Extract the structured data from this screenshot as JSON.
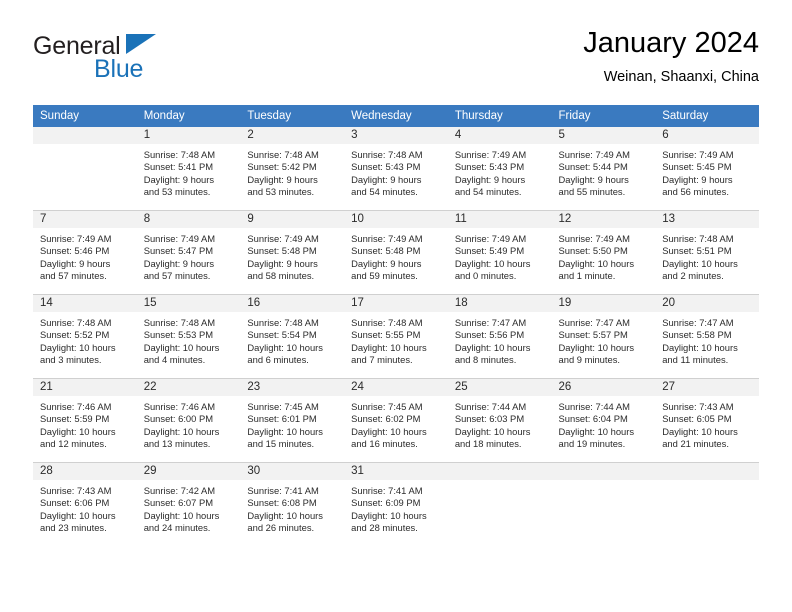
{
  "brand": {
    "name_part1": "General",
    "name_part2": "Blue",
    "triangle_icon": "triangle-logo-icon",
    "color_primary": "#1a72b8",
    "color_text": "#231f20"
  },
  "header": {
    "title": "January 2024",
    "subtitle": "Weinan, Shaanxi, China"
  },
  "theme": {
    "header_bg": "#3a7ac0",
    "header_text": "#ffffff",
    "daynum_band_bg": "#f2f2f2",
    "grid_line": "#d0d0d0",
    "page_bg": "#ffffff"
  },
  "weekday_headers": [
    "Sunday",
    "Monday",
    "Tuesday",
    "Wednesday",
    "Thursday",
    "Friday",
    "Saturday"
  ],
  "weeks": [
    [
      {
        "day": "",
        "empty": true,
        "sunrise": "",
        "sunset": "",
        "daylight_line1": "",
        "daylight_line2": ""
      },
      {
        "day": "1",
        "empty": false,
        "sunrise": "Sunrise: 7:48 AM",
        "sunset": "Sunset: 5:41 PM",
        "daylight_line1": "Daylight: 9 hours",
        "daylight_line2": "and 53 minutes."
      },
      {
        "day": "2",
        "empty": false,
        "sunrise": "Sunrise: 7:48 AM",
        "sunset": "Sunset: 5:42 PM",
        "daylight_line1": "Daylight: 9 hours",
        "daylight_line2": "and 53 minutes."
      },
      {
        "day": "3",
        "empty": false,
        "sunrise": "Sunrise: 7:48 AM",
        "sunset": "Sunset: 5:43 PM",
        "daylight_line1": "Daylight: 9 hours",
        "daylight_line2": "and 54 minutes."
      },
      {
        "day": "4",
        "empty": false,
        "sunrise": "Sunrise: 7:49 AM",
        "sunset": "Sunset: 5:43 PM",
        "daylight_line1": "Daylight: 9 hours",
        "daylight_line2": "and 54 minutes."
      },
      {
        "day": "5",
        "empty": false,
        "sunrise": "Sunrise: 7:49 AM",
        "sunset": "Sunset: 5:44 PM",
        "daylight_line1": "Daylight: 9 hours",
        "daylight_line2": "and 55 minutes."
      },
      {
        "day": "6",
        "empty": false,
        "sunrise": "Sunrise: 7:49 AM",
        "sunset": "Sunset: 5:45 PM",
        "daylight_line1": "Daylight: 9 hours",
        "daylight_line2": "and 56 minutes."
      }
    ],
    [
      {
        "day": "7",
        "empty": false,
        "sunrise": "Sunrise: 7:49 AM",
        "sunset": "Sunset: 5:46 PM",
        "daylight_line1": "Daylight: 9 hours",
        "daylight_line2": "and 57 minutes."
      },
      {
        "day": "8",
        "empty": false,
        "sunrise": "Sunrise: 7:49 AM",
        "sunset": "Sunset: 5:47 PM",
        "daylight_line1": "Daylight: 9 hours",
        "daylight_line2": "and 57 minutes."
      },
      {
        "day": "9",
        "empty": false,
        "sunrise": "Sunrise: 7:49 AM",
        "sunset": "Sunset: 5:48 PM",
        "daylight_line1": "Daylight: 9 hours",
        "daylight_line2": "and 58 minutes."
      },
      {
        "day": "10",
        "empty": false,
        "sunrise": "Sunrise: 7:49 AM",
        "sunset": "Sunset: 5:48 PM",
        "daylight_line1": "Daylight: 9 hours",
        "daylight_line2": "and 59 minutes."
      },
      {
        "day": "11",
        "empty": false,
        "sunrise": "Sunrise: 7:49 AM",
        "sunset": "Sunset: 5:49 PM",
        "daylight_line1": "Daylight: 10 hours",
        "daylight_line2": "and 0 minutes."
      },
      {
        "day": "12",
        "empty": false,
        "sunrise": "Sunrise: 7:49 AM",
        "sunset": "Sunset: 5:50 PM",
        "daylight_line1": "Daylight: 10 hours",
        "daylight_line2": "and 1 minute."
      },
      {
        "day": "13",
        "empty": false,
        "sunrise": "Sunrise: 7:48 AM",
        "sunset": "Sunset: 5:51 PM",
        "daylight_line1": "Daylight: 10 hours",
        "daylight_line2": "and 2 minutes."
      }
    ],
    [
      {
        "day": "14",
        "empty": false,
        "sunrise": "Sunrise: 7:48 AM",
        "sunset": "Sunset: 5:52 PM",
        "daylight_line1": "Daylight: 10 hours",
        "daylight_line2": "and 3 minutes."
      },
      {
        "day": "15",
        "empty": false,
        "sunrise": "Sunrise: 7:48 AM",
        "sunset": "Sunset: 5:53 PM",
        "daylight_line1": "Daylight: 10 hours",
        "daylight_line2": "and 4 minutes."
      },
      {
        "day": "16",
        "empty": false,
        "sunrise": "Sunrise: 7:48 AM",
        "sunset": "Sunset: 5:54 PM",
        "daylight_line1": "Daylight: 10 hours",
        "daylight_line2": "and 6 minutes."
      },
      {
        "day": "17",
        "empty": false,
        "sunrise": "Sunrise: 7:48 AM",
        "sunset": "Sunset: 5:55 PM",
        "daylight_line1": "Daylight: 10 hours",
        "daylight_line2": "and 7 minutes."
      },
      {
        "day": "18",
        "empty": false,
        "sunrise": "Sunrise: 7:47 AM",
        "sunset": "Sunset: 5:56 PM",
        "daylight_line1": "Daylight: 10 hours",
        "daylight_line2": "and 8 minutes."
      },
      {
        "day": "19",
        "empty": false,
        "sunrise": "Sunrise: 7:47 AM",
        "sunset": "Sunset: 5:57 PM",
        "daylight_line1": "Daylight: 10 hours",
        "daylight_line2": "and 9 minutes."
      },
      {
        "day": "20",
        "empty": false,
        "sunrise": "Sunrise: 7:47 AM",
        "sunset": "Sunset: 5:58 PM",
        "daylight_line1": "Daylight: 10 hours",
        "daylight_line2": "and 11 minutes."
      }
    ],
    [
      {
        "day": "21",
        "empty": false,
        "sunrise": "Sunrise: 7:46 AM",
        "sunset": "Sunset: 5:59 PM",
        "daylight_line1": "Daylight: 10 hours",
        "daylight_line2": "and 12 minutes."
      },
      {
        "day": "22",
        "empty": false,
        "sunrise": "Sunrise: 7:46 AM",
        "sunset": "Sunset: 6:00 PM",
        "daylight_line1": "Daylight: 10 hours",
        "daylight_line2": "and 13 minutes."
      },
      {
        "day": "23",
        "empty": false,
        "sunrise": "Sunrise: 7:45 AM",
        "sunset": "Sunset: 6:01 PM",
        "daylight_line1": "Daylight: 10 hours",
        "daylight_line2": "and 15 minutes."
      },
      {
        "day": "24",
        "empty": false,
        "sunrise": "Sunrise: 7:45 AM",
        "sunset": "Sunset: 6:02 PM",
        "daylight_line1": "Daylight: 10 hours",
        "daylight_line2": "and 16 minutes."
      },
      {
        "day": "25",
        "empty": false,
        "sunrise": "Sunrise: 7:44 AM",
        "sunset": "Sunset: 6:03 PM",
        "daylight_line1": "Daylight: 10 hours",
        "daylight_line2": "and 18 minutes."
      },
      {
        "day": "26",
        "empty": false,
        "sunrise": "Sunrise: 7:44 AM",
        "sunset": "Sunset: 6:04 PM",
        "daylight_line1": "Daylight: 10 hours",
        "daylight_line2": "and 19 minutes."
      },
      {
        "day": "27",
        "empty": false,
        "sunrise": "Sunrise: 7:43 AM",
        "sunset": "Sunset: 6:05 PM",
        "daylight_line1": "Daylight: 10 hours",
        "daylight_line2": "and 21 minutes."
      }
    ],
    [
      {
        "day": "28",
        "empty": false,
        "sunrise": "Sunrise: 7:43 AM",
        "sunset": "Sunset: 6:06 PM",
        "daylight_line1": "Daylight: 10 hours",
        "daylight_line2": "and 23 minutes."
      },
      {
        "day": "29",
        "empty": false,
        "sunrise": "Sunrise: 7:42 AM",
        "sunset": "Sunset: 6:07 PM",
        "daylight_line1": "Daylight: 10 hours",
        "daylight_line2": "and 24 minutes."
      },
      {
        "day": "30",
        "empty": false,
        "sunrise": "Sunrise: 7:41 AM",
        "sunset": "Sunset: 6:08 PM",
        "daylight_line1": "Daylight: 10 hours",
        "daylight_line2": "and 26 minutes."
      },
      {
        "day": "31",
        "empty": false,
        "sunrise": "Sunrise: 7:41 AM",
        "sunset": "Sunset: 6:09 PM",
        "daylight_line1": "Daylight: 10 hours",
        "daylight_line2": "and 28 minutes."
      },
      {
        "day": "",
        "empty": true,
        "sunrise": "",
        "sunset": "",
        "daylight_line1": "",
        "daylight_line2": ""
      },
      {
        "day": "",
        "empty": true,
        "sunrise": "",
        "sunset": "",
        "daylight_line1": "",
        "daylight_line2": ""
      },
      {
        "day": "",
        "empty": true,
        "sunrise": "",
        "sunset": "",
        "daylight_line1": "",
        "daylight_line2": ""
      }
    ]
  ]
}
